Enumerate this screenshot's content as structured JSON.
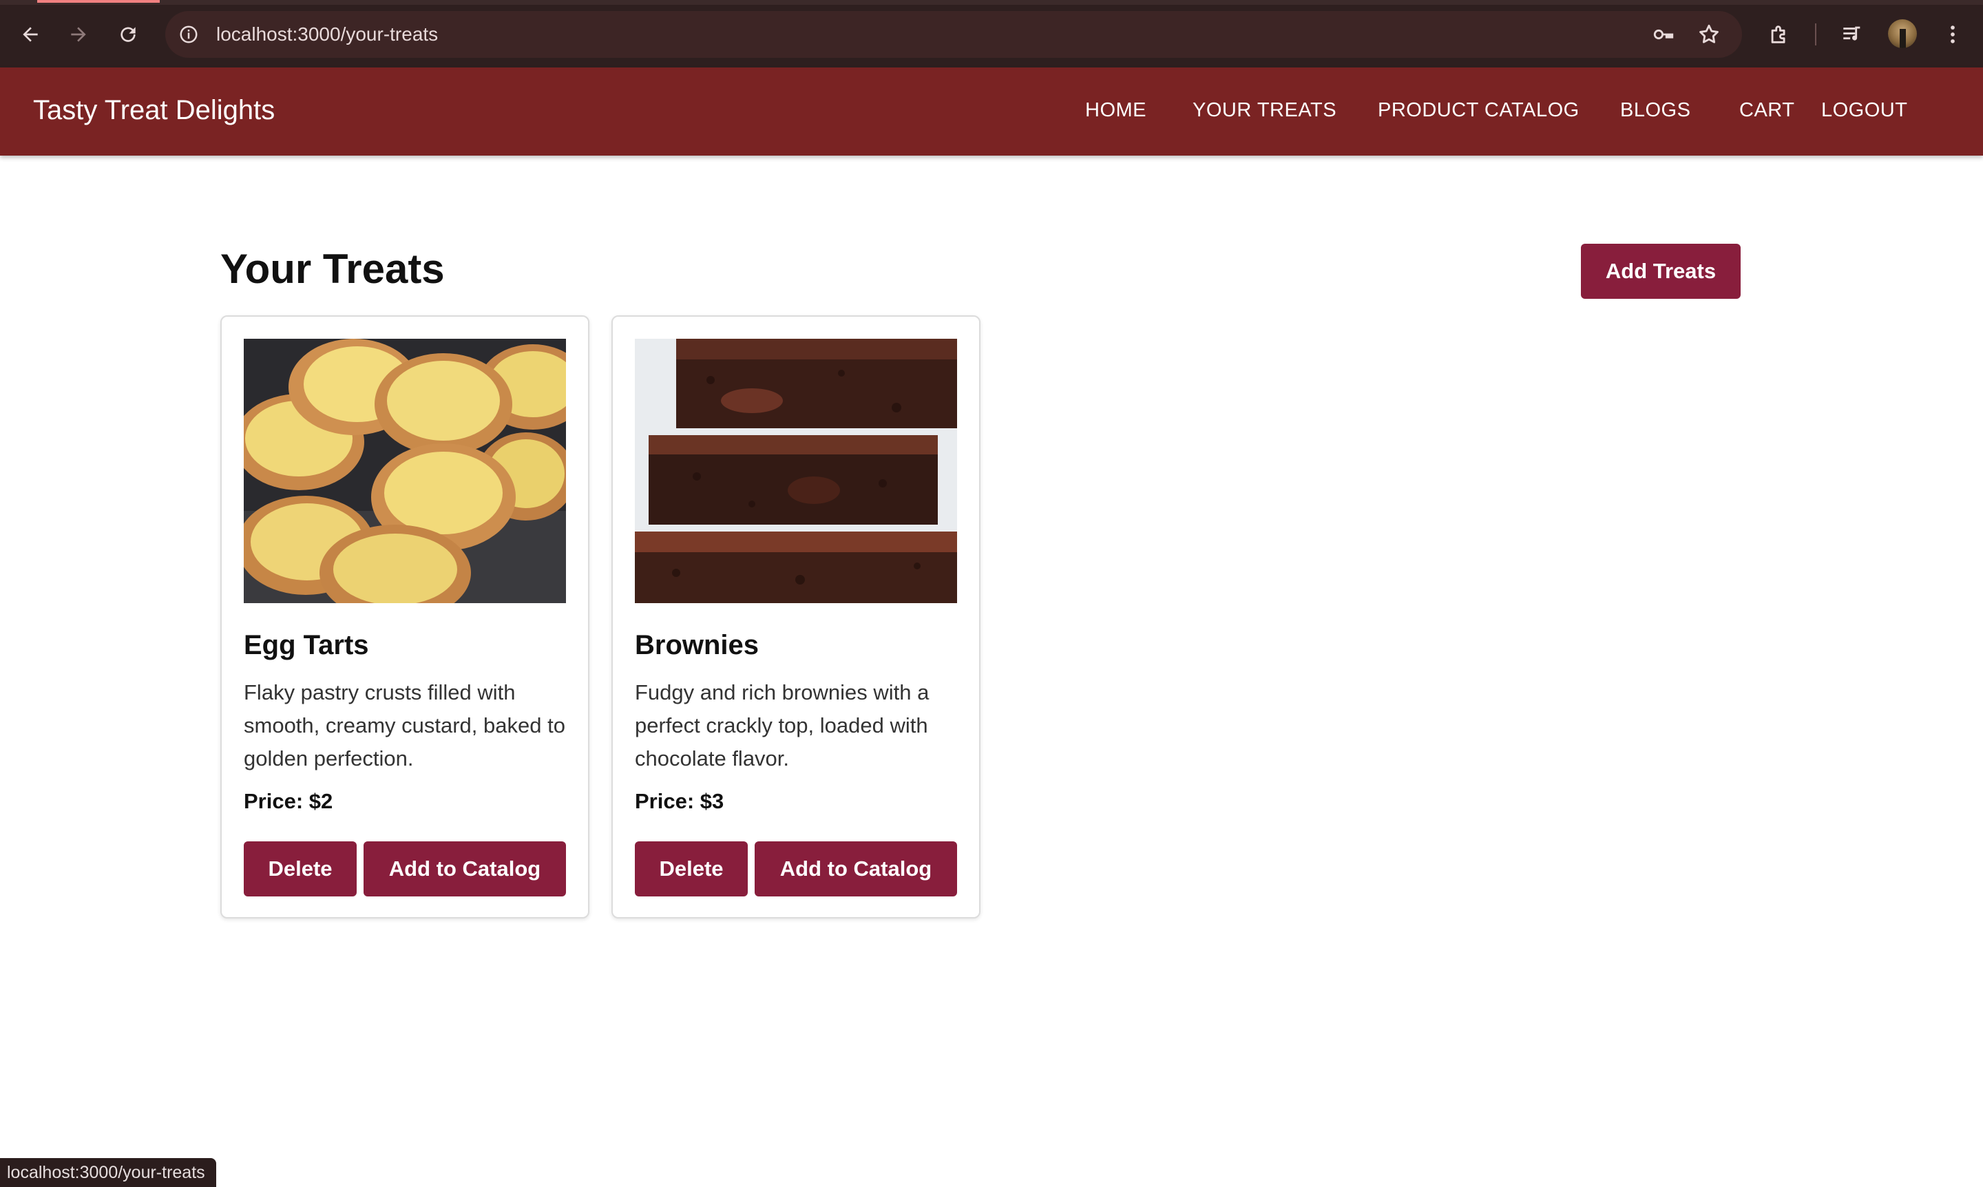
{
  "browser": {
    "url": "localhost:3000/your-treats",
    "icons": [
      "back-icon",
      "forward-icon",
      "reload-icon",
      "site-info-icon",
      "password-key-icon",
      "bookmark-star-icon",
      "extensions-icon",
      "media-control-icon",
      "profile-avatar",
      "more-menu-icon"
    ]
  },
  "header": {
    "brand": "Tasty Treat Delights",
    "nav": [
      "HOME",
      "YOUR TREATS",
      "PRODUCT CATALOG",
      "BLOGS",
      "CART",
      "LOGOUT"
    ],
    "background": "#7a2323"
  },
  "main": {
    "title": "Your Treats",
    "add_button": "Add Treats",
    "accent": "#881e3c",
    "treats": [
      {
        "name": "Egg Tarts",
        "description": "Flaky pastry crusts filled with smooth, creamy custard, baked to golden perfection.",
        "price": "Price: $2",
        "delete_label": "Delete",
        "catalog_label": "Add to Catalog"
      },
      {
        "name": "Brownies",
        "description": "Fudgy and rich brownies with a perfect crackly top, loaded with chocolate flavor.",
        "price": "Price: $3",
        "delete_label": "Delete",
        "catalog_label": "Add to Catalog"
      }
    ]
  },
  "status_bar": {
    "text": "localhost:3000/your-treats"
  }
}
